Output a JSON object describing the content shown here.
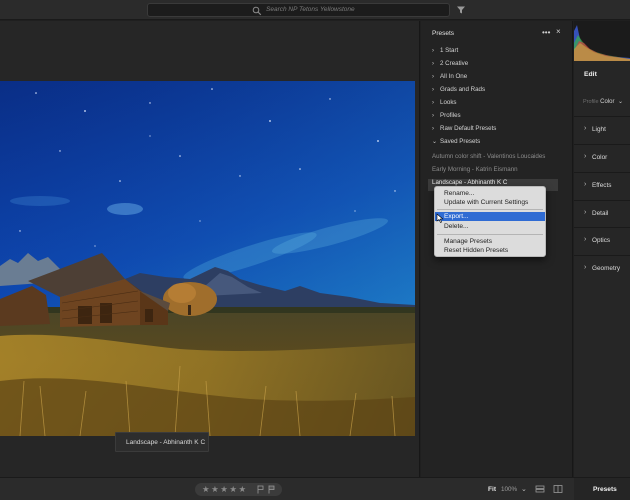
{
  "topbar": {
    "search_placeholder": "Search NP Tetons Yellowstone"
  },
  "canvas": {
    "tooltip": "Landscape - Abhinanth K C"
  },
  "presets_panel": {
    "title": "Presets",
    "more_icon": "•••",
    "close_icon": "×",
    "items": [
      {
        "label": "1 Start",
        "chevron": "›"
      },
      {
        "label": "2 Creative",
        "chevron": "›"
      },
      {
        "label": "All In One",
        "chevron": "›"
      },
      {
        "label": "Grads and Rads",
        "chevron": "›"
      },
      {
        "label": "Looks",
        "chevron": "›"
      },
      {
        "label": "Profiles",
        "chevron": "›"
      },
      {
        "label": "Raw Default Presets",
        "chevron": "›"
      },
      {
        "label": "Saved Presets",
        "chevron": "⌄"
      }
    ],
    "sub_items": [
      "Autumn color shift - Valentinos Loucaides",
      "Early Morning - Katrin Eismann",
      "Landscape - Abhinanth K C"
    ]
  },
  "context_menu": {
    "items": [
      "Rename...",
      "Update with Current Settings",
      "Export...",
      "Delete...",
      "Manage Presets",
      "Reset Hidden Presets"
    ],
    "highlighted": "Export..."
  },
  "edit_panel": {
    "title": "Edit",
    "profile_label": "Profile",
    "profile_value": "Color",
    "profile_chevron": "⌄",
    "sections": [
      "Light",
      "Color",
      "Effects",
      "Detail",
      "Optics",
      "Geometry"
    ],
    "section_chevron": "›"
  },
  "bottombar": {
    "stars": "★★★★★",
    "fit_label": "Fit",
    "zoom_value": "100%",
    "zoom_chevron": "⌄",
    "presets_button": "Presets"
  },
  "colors": {
    "highlight": "#2f6bd3",
    "panel_bg": "#232323",
    "menu_bg": "#dcdcdc"
  }
}
